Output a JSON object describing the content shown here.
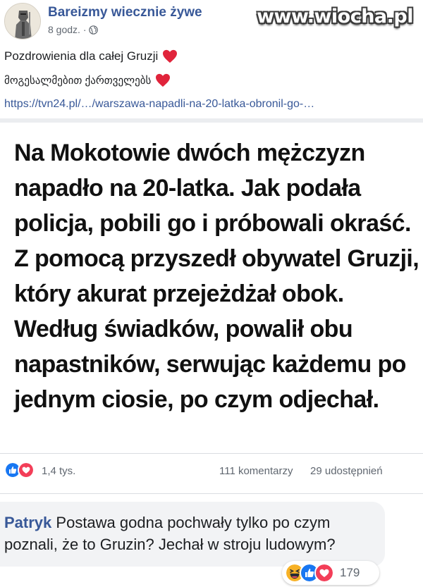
{
  "post": {
    "page_name": "Bareizmy wiecznie żywe",
    "time": "8 godz. ·",
    "watermark": "www.wiocha.pl",
    "text_line1": "Pozdrowienia dla całej Gruzji",
    "text_line2": "მოგესალმებით ქართველებს",
    "link": "https://tvn24.pl/…/warszawa-napadli-na-20-latka-obronil-go-…",
    "card_text": "Na Mokotowie dwóch mężczyzn napadło na 20-latka. Jak podała policja, pobili go i próbowali okraść. Z pomocą przyszedł obywatel Gruzji, który akurat przejeżdżał obok. Według świadków, powalił obu napastników, serwując każdemu po jednym ciosie, po czym odjechał."
  },
  "stats": {
    "reactions_count": "1,4 tys.",
    "comments": "111 komentarzy",
    "shares": "29 udostępnień"
  },
  "comment": {
    "author": "Patryk",
    "text": "Postawa godna pochwały tylko po czym poznali, że to Gruzin? Jechał w stroju ludowym?",
    "reactions_count": "179"
  },
  "colors": {
    "link_blue": "#385898",
    "like_blue": "#1877f2",
    "love_red": "#f33e58",
    "haha_yellow": "#f7b125"
  },
  "icons": [
    "avatar-knight-icon",
    "globe-icon",
    "heart-emoji-icon",
    "like-reaction-icon",
    "love-reaction-icon",
    "haha-reaction-icon"
  ]
}
